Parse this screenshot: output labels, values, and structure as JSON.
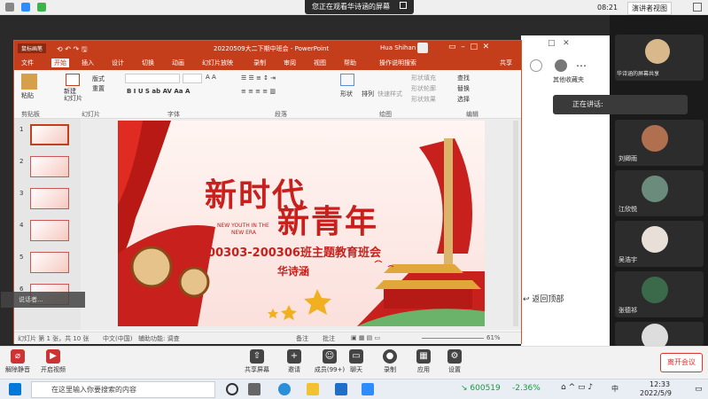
{
  "topbar": {
    "banner": "您正在观看华诗涵的屏幕",
    "time": "08:21",
    "view_label": "演讲者视图"
  },
  "ppt": {
    "window_title": "20220509大二下期中班会 - PowerPoint",
    "user": "Hua Shihan",
    "pen_label": "鼠标画笔",
    "tabs": [
      "文件",
      "开始",
      "插入",
      "设计",
      "切换",
      "动画",
      "幻灯片放映",
      "录制",
      "审阅",
      "视图",
      "帮助"
    ],
    "tell_me": "操作说明搜索",
    "share": "共享",
    "ribbon": {
      "paste": "粘贴",
      "clipboard": "剪贴板",
      "new_slide": "新建\n幻灯片",
      "layout": "版式",
      "reset": "重置",
      "slides": "幻灯片",
      "font": "字体",
      "paragraph": "段落",
      "shapes": "形状",
      "arrange": "排列",
      "quick_styles": "快速样式",
      "shape_fill": "形状填充",
      "shape_outline": "形状轮廓",
      "shape_effect": "形状效果",
      "drawing": "绘图",
      "find": "查找",
      "replace": "替换",
      "select": "选择",
      "editing": "编辑",
      "font_size_btns": "A A"
    },
    "slide": {
      "title_line1": "新时代",
      "title_line2": "新青年",
      "subtitle_en1": "NEW YOUTH IN THE",
      "subtitle_en2": "NEW ERA",
      "class_title": "200303-200306班主题教育班会",
      "presenter": "华诗涵"
    },
    "thumb_numbers": [
      "1",
      "2",
      "3",
      "4",
      "5",
      "6"
    ],
    "status": {
      "slide_info": "幻灯片 第 1 张，共 10 张",
      "lang": "中文(中国)",
      "access": "辅助功能: 调查",
      "notes": "备注",
      "comments": "批注",
      "zoom": "61%"
    },
    "speaking_overlay": "说话者..."
  },
  "browser": {
    "favorites": "其他收藏夹",
    "back_top": "返回顶部"
  },
  "participants": {
    "share_label": "华诗涵的屏幕共享",
    "speaking": "正在讲话:",
    "names": [
      "刘卿雨",
      "江欣悦",
      "吴浩宇",
      "张德祁"
    ]
  },
  "meetbar": {
    "mute": "解除静音",
    "video": "开启视频",
    "share": "共享屏幕",
    "invite": "邀请",
    "members": "成员(99+)",
    "chat": "聊天",
    "record": "录制",
    "apps": "应用",
    "settings": "设置",
    "leave": "离开会议"
  },
  "taskbar": {
    "search_placeholder": "在这里输入你要搜索的内容",
    "stock_code": "600519",
    "stock_change": "-2.36%",
    "time": "12:33",
    "date": "2022/5/9",
    "ime": "中"
  },
  "colors": {
    "ppt_red": "#c43e1c",
    "slide_red": "#c8201c",
    "leave_red": "#d33333"
  }
}
